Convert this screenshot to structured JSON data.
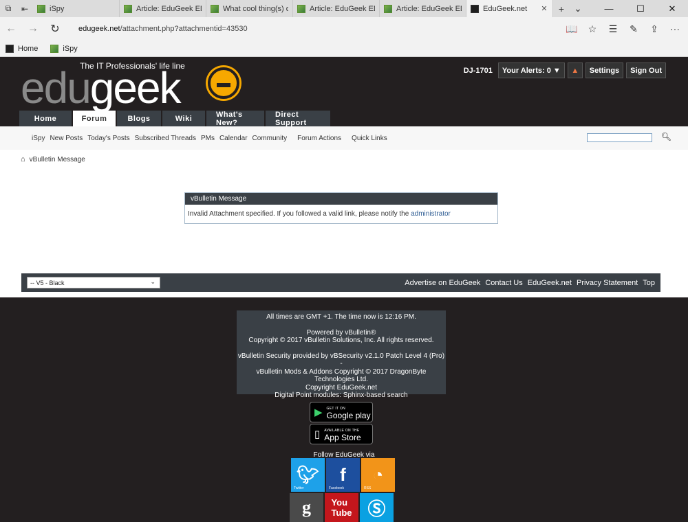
{
  "browser": {
    "tabs": [
      {
        "label": "iSpy",
        "active": false
      },
      {
        "label": "Article: EduGeek EDIT",
        "active": false
      },
      {
        "label": "What cool thing(s) dic",
        "active": false
      },
      {
        "label": "Article: EduGeek EDIT",
        "active": false
      },
      {
        "label": "Article: EduGeek EDIT",
        "active": false
      },
      {
        "label": "EduGeek.net",
        "active": true
      }
    ],
    "url_host": "edugeek.net",
    "url_path": "/attachment.php?attachmentid=43530",
    "favorites": [
      "Home",
      "iSpy"
    ]
  },
  "header": {
    "tagline": "The IT Professionals' life line",
    "logo_edu": "edu",
    "logo_geek": "geek",
    "username": "DJ-1701",
    "alerts_label": "Your Alerts: 0 ▼",
    "settings_label": "Settings",
    "signout_label": "Sign Out",
    "main_tabs": [
      "Home",
      "Forum",
      "Blogs",
      "Wiki",
      "What's New?",
      "Direct Support"
    ],
    "active_tab": "Forum"
  },
  "subnav": {
    "links": [
      "iSpy",
      "New Posts",
      "Today's Posts",
      "Subscribed Threads",
      "PMs",
      "Calendar",
      "Community",
      "Forum Actions",
      "Quick Links"
    ]
  },
  "content": {
    "breadcrumb": "vBulletin Message",
    "message_title": "vBulletin Message",
    "message_text": "Invalid Attachment specified. If you followed a valid link, please notify the ",
    "message_link": "administrator",
    "style_selected": "-- V5 - Black",
    "footer_links": [
      "Advertise on EduGeek",
      "Contact Us",
      "EduGeek.net",
      "Privacy Statement",
      "Top"
    ]
  },
  "footer": {
    "time_line": "All times are GMT +1. The time now is 12:16 PM.",
    "powered": "Powered by vBulletin®",
    "copyright1": "Copyright © 2017 vBulletin Solutions, Inc. All rights reserved.",
    "security1": "vBulletin Security provided by vBSecurity v2.1.0 Patch Level 4 (Pro) -",
    "security2": "vBulletin Mods & Addons Copyright © 2017 DragonByte",
    "security3": "Technologies Ltd.",
    "copyright2": "Copyright EduGeek.net",
    "modules": "Digital Point modules: Sphinx-based search",
    "google_small": "GET IT ON",
    "google_big": "Google play",
    "apple_small": "AVAILABLE ON THE",
    "apple_big": "App Store",
    "follow": "Follow EduGeek via",
    "social": [
      {
        "name": "twitter",
        "label": "Twitter",
        "color": "#1ea1e9"
      },
      {
        "name": "facebook",
        "label": "Facebook",
        "color": "#1d4f9e"
      },
      {
        "name": "rss",
        "label": "RSS",
        "color": "#f29419"
      },
      {
        "name": "google-plus",
        "label": "",
        "color": "#4a4a4a"
      },
      {
        "name": "youtube",
        "label": "",
        "color": "#c4161c"
      },
      {
        "name": "skype",
        "label": "",
        "color": "#0aa1e2"
      }
    ]
  }
}
